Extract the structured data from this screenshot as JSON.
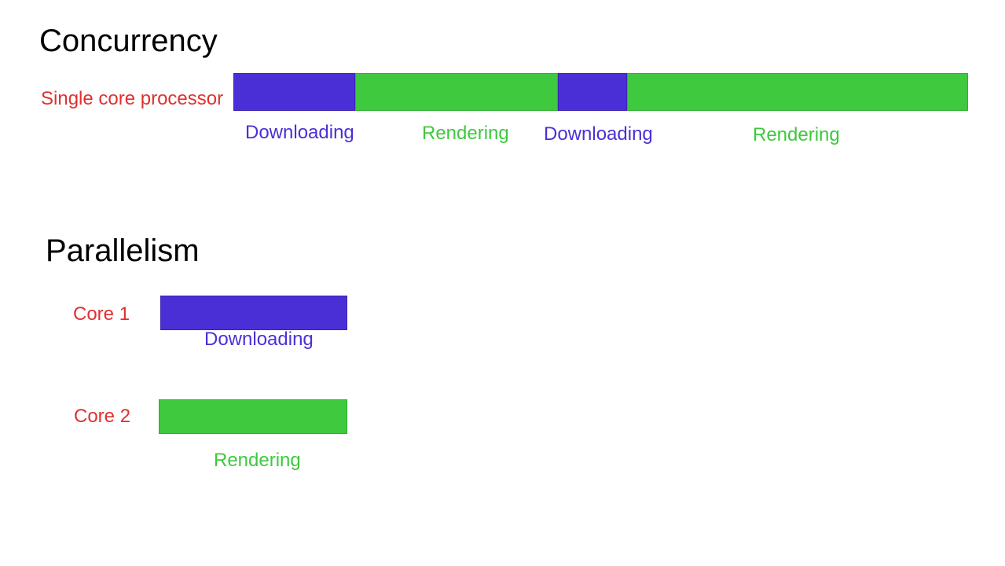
{
  "concurrency": {
    "title": "Concurrency",
    "row_label": "Single core processor",
    "segments": [
      {
        "label": "Downloading",
        "type": "purple"
      },
      {
        "label": "Rendering",
        "type": "green"
      },
      {
        "label": "Downloading",
        "type": "purple"
      },
      {
        "label": "Rendering",
        "type": "green"
      }
    ]
  },
  "parallelism": {
    "title": "Parallelism",
    "rows": [
      {
        "label": "Core 1",
        "segment": {
          "label": "Downloading",
          "type": "purple"
        }
      },
      {
        "label": "Core 2",
        "segment": {
          "label": "Rendering",
          "type": "green"
        }
      }
    ]
  },
  "colors": {
    "purple": "#4b2fd6",
    "green": "#3ec93e",
    "label_red": "#e03030"
  }
}
